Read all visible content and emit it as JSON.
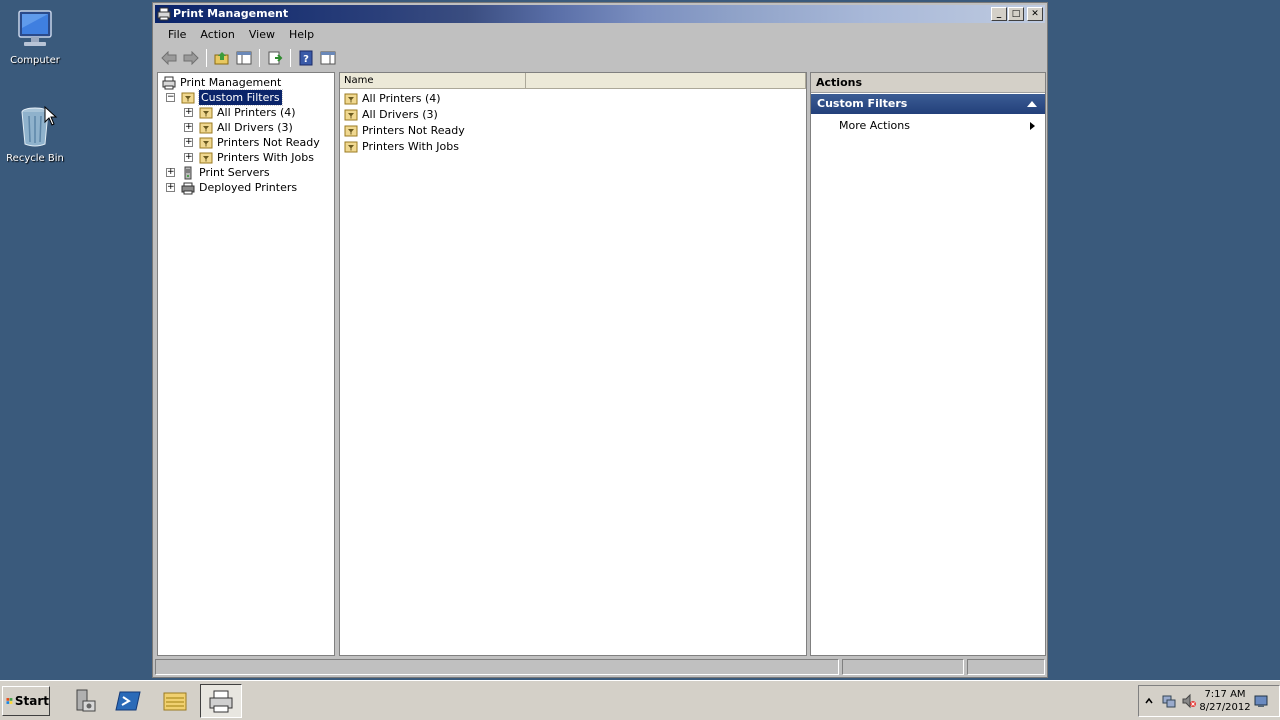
{
  "desktop": {
    "icons": [
      {
        "label": "Computer"
      },
      {
        "label": "Recycle Bin"
      }
    ]
  },
  "window": {
    "title": "Print Management",
    "menu": [
      "File",
      "Action",
      "View",
      "Help"
    ],
    "tree": {
      "root": "Print Management",
      "custom_filters": "Custom Filters",
      "filters": [
        "All Printers (4)",
        "All Drivers (3)",
        "Printers Not Ready",
        "Printers With Jobs"
      ],
      "print_servers": "Print Servers",
      "deployed_printers": "Deployed Printers"
    },
    "list": {
      "column_name": "Name",
      "items": [
        "All Printers (4)",
        "All Drivers (3)",
        "Printers Not Ready",
        "Printers With Jobs"
      ]
    },
    "actions": {
      "header": "Actions",
      "section": "Custom Filters",
      "more_actions": "More Actions"
    }
  },
  "taskbar": {
    "start_label": "Start",
    "clock_time": "7:17 AM",
    "clock_date": "8/27/2012"
  },
  "colors": {
    "desktop": "#3a5a7c",
    "selection": "#0a246a",
    "actions_section": "#2e4c86"
  }
}
